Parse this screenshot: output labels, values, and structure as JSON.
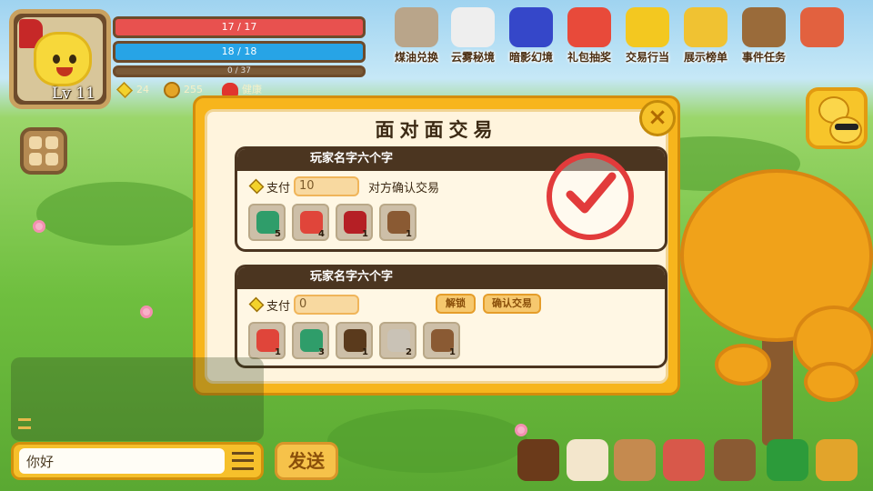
{
  "player": {
    "level": "Lv 11",
    "hp": "17 / 17",
    "mp": "18 / 18",
    "xp": "0 / 37",
    "gems": "24",
    "coins": "255",
    "health_status": "健康"
  },
  "top_menu": [
    {
      "label": "煤油兑换",
      "icon": "kerosene-bag-icon",
      "color": "#b9a58a"
    },
    {
      "label": "云雾秘境",
      "icon": "cloud-icon",
      "color": "#eeeeee"
    },
    {
      "label": "暗影幻境",
      "icon": "dark-crystal-icon",
      "color": "#3547c9"
    },
    {
      "label": "礼包抽奖",
      "icon": "gift-box-icon",
      "color": "#e84a3a"
    },
    {
      "label": "交易行当",
      "icon": "gold-bars-icon",
      "color": "#f3c820"
    },
    {
      "label": "展示榜单",
      "icon": "medal-icon",
      "color": "#f0c232"
    },
    {
      "label": "事件任务",
      "icon": "scroll-icon",
      "color": "#9a6b3a"
    },
    {
      "label": "",
      "icon": "shop-stall-icon",
      "color": "#e2613f"
    }
  ],
  "dialog": {
    "title": "面对面交易",
    "close_icon": "close-icon",
    "other_player": {
      "name": "玩家名字六个字",
      "pay_label": "支付",
      "pay_amount": "10",
      "status": "对方确认交易",
      "confirmed": true,
      "items": [
        {
          "name": "herb",
          "qty": "5",
          "color": "#2f9d6a"
        },
        {
          "name": "apple",
          "qty": "4",
          "color": "#e0453a"
        },
        {
          "name": "berry",
          "qty": "1",
          "color": "#b51f25"
        },
        {
          "name": "wood",
          "qty": "1",
          "color": "#8a5a33"
        }
      ]
    },
    "self_player": {
      "name": "玩家名字六个字",
      "pay_label": "支付",
      "pay_amount": "0",
      "unlock_label": "解锁",
      "confirm_label": "确认交易",
      "items": [
        {
          "name": "apple",
          "qty": "1",
          "color": "#e0453a"
        },
        {
          "name": "herb",
          "qty": "3",
          "color": "#2f9d6a"
        },
        {
          "name": "seed",
          "qty": "1",
          "color": "#5a3a1c"
        },
        {
          "name": "stone",
          "qty": "2",
          "color": "#c9c2b6"
        },
        {
          "name": "wood",
          "qty": "1",
          "color": "#8a5a33"
        }
      ]
    }
  },
  "chat": {
    "input_value": "你好",
    "send_label": "发送"
  },
  "bottom_bar": [
    {
      "icon": "crosshair-icon",
      "color": "#6b3a1a"
    },
    {
      "icon": "pet-paw-icon",
      "color": "#f3e6cc"
    },
    {
      "icon": "mail-icon",
      "color": "#c58a4f"
    },
    {
      "icon": "house-icon",
      "color": "#d8584a"
    },
    {
      "icon": "backpack-icon",
      "color": "#8a5a33"
    },
    {
      "icon": "clover-icon",
      "color": "#2c9b3a"
    },
    {
      "icon": "settings-gear-icon",
      "color": "#e2a42b"
    }
  ]
}
